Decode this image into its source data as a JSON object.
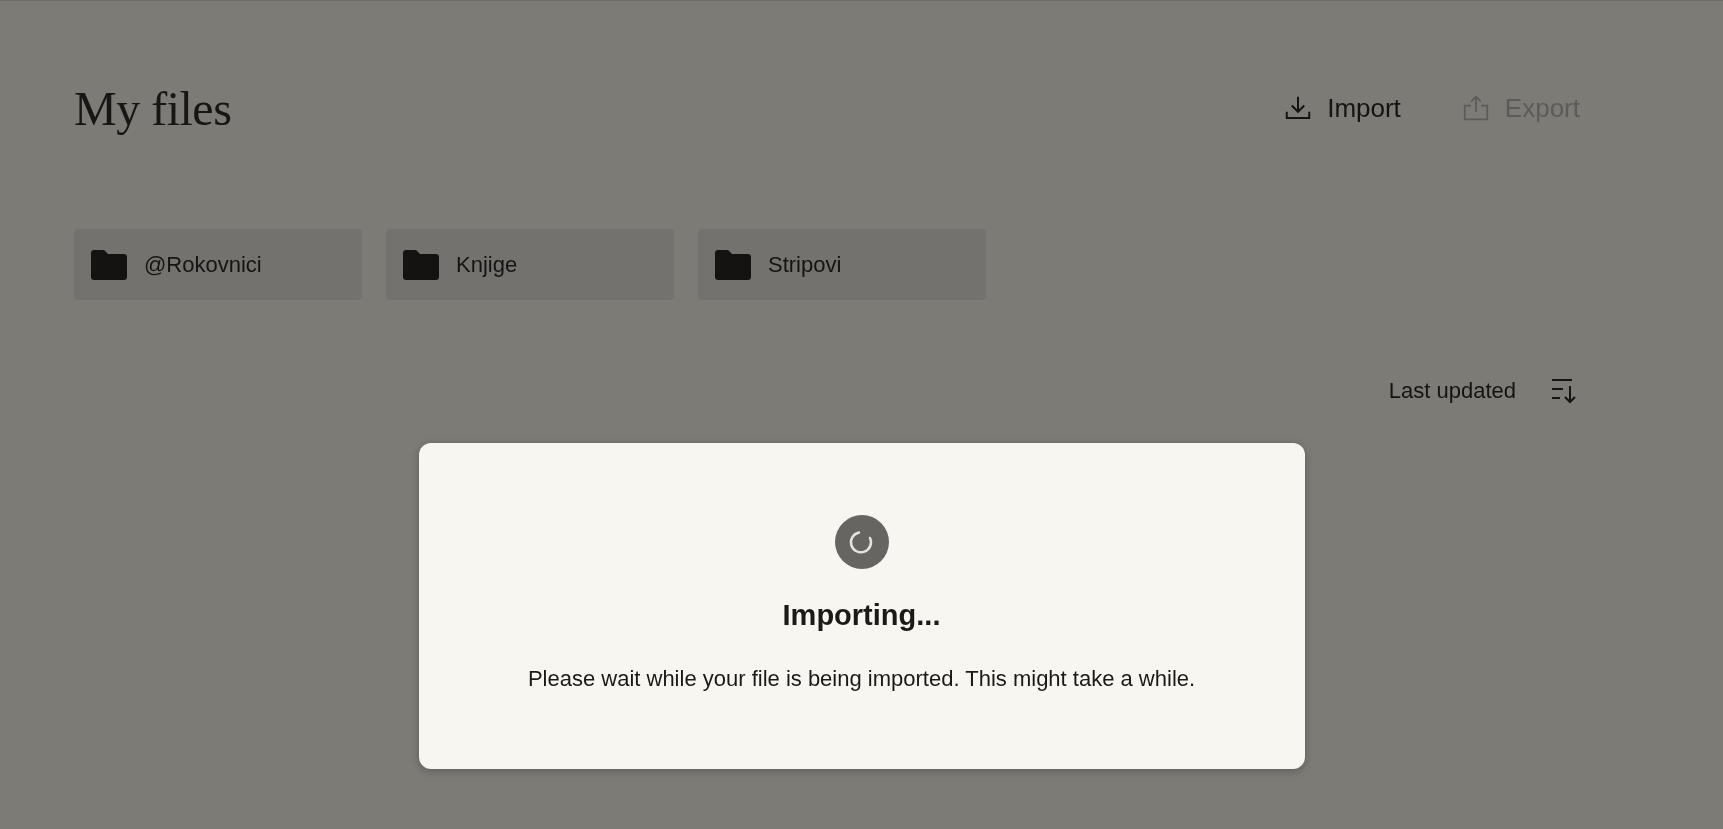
{
  "title": "My files",
  "actions": [
    {
      "kind": "import",
      "label": "Import",
      "disabled": false
    },
    {
      "kind": "export",
      "label": "Export",
      "disabled": true
    }
  ],
  "folders": [
    {
      "name": "@Rokovnici"
    },
    {
      "name": "Knjige"
    },
    {
      "name": "Stripovi"
    }
  ],
  "sort": {
    "label": "Last updated"
  },
  "dialog": {
    "title": "Importing...",
    "message": "Please wait while your file is being imported. This might take a while."
  }
}
